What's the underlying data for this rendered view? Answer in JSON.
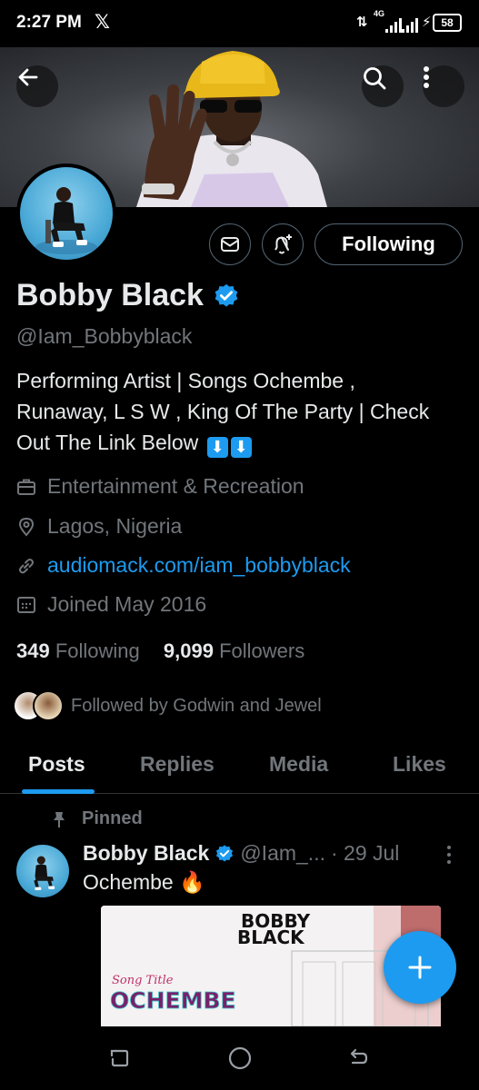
{
  "status_bar": {
    "time": "2:27 PM",
    "app_icon": "x-logo-icon",
    "network": "4G",
    "battery": "58"
  },
  "header": {
    "back_icon": "arrow-left-icon",
    "search_icon": "search-icon",
    "more_icon": "more-vertical-icon"
  },
  "profile": {
    "name": "Bobby Black",
    "handle": "@Iam_Bobbyblack",
    "bio": "Performing Artist | Songs Ochembe , Runaway, L S W , King Of The Party | Check Out The Link Below",
    "bio_emoji": [
      "⬇",
      "⬇"
    ],
    "category": "Entertainment & Recreation",
    "location": "Lagos, Nigeria",
    "website": "audiomack.com/iam_bobbyblack",
    "joined": "Joined May 2016",
    "following_count": "349",
    "following_label": "Following",
    "followers_count": "9,099",
    "followers_label": "Followers",
    "followed_by": "Followed by Godwin and Jewel",
    "follow_button": "Following",
    "accent_color": "#1d9bf0"
  },
  "tabs": [
    "Posts",
    "Replies",
    "Media",
    "Likes"
  ],
  "active_tab": "Posts",
  "pinned_post": {
    "pinned_label": "Pinned",
    "author": "Bobby Black",
    "handle": "@Iam_...",
    "date": "· 29 Jul",
    "text": "Ochembe 🔥",
    "media": {
      "line1": "BOBBY",
      "line2": "BLACK",
      "script": "Song Title",
      "title": "OCHEMBE"
    }
  },
  "fab_icon": "plus-icon",
  "nav_bar": [
    "recents-icon",
    "home-circle-icon",
    "back-nav-icon"
  ]
}
